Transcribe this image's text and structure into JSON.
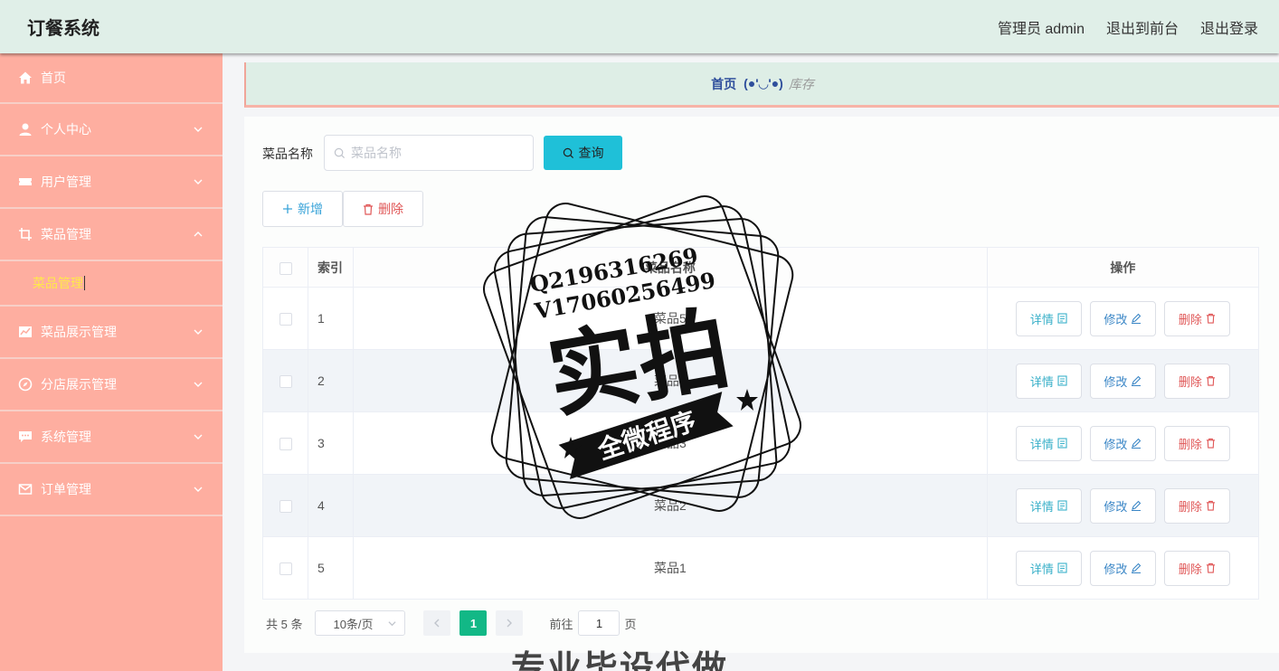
{
  "app": {
    "title": "订餐系统"
  },
  "header": {
    "user_label": "管理员 admin",
    "front_link": "退出到前台",
    "logout_link": "退出登录"
  },
  "sidebar": {
    "items": [
      {
        "label": "首页",
        "icon": "home-icon"
      },
      {
        "label": "个人中心",
        "icon": "user-icon"
      },
      {
        "label": "用户管理",
        "icon": "ticket-icon"
      },
      {
        "label": "菜品管理",
        "icon": "crop-icon",
        "expanded": true
      },
      {
        "label": "菜品展示管理",
        "icon": "chart-icon"
      },
      {
        "label": "分店展示管理",
        "icon": "compass-icon"
      },
      {
        "label": "系统管理",
        "icon": "chat-icon"
      },
      {
        "label": "订单管理",
        "icon": "mail-icon"
      }
    ],
    "active_sub": "菜品管理"
  },
  "breadcrumb": {
    "home": "首页",
    "face": "(●'◡'●)",
    "current": "库存"
  },
  "search": {
    "label": "菜品名称",
    "placeholder": "菜品名称",
    "value": "",
    "query_button": "查询"
  },
  "actions": {
    "add": "新增",
    "delete": "删除"
  },
  "table": {
    "headers": {
      "index": "索引",
      "name": "菜品名称",
      "ops": "操作"
    },
    "rows": [
      {
        "index": "1",
        "name": "菜品5"
      },
      {
        "index": "2",
        "name": "菜品4"
      },
      {
        "index": "3",
        "name": "菜品3"
      },
      {
        "index": "4",
        "name": "菜品2"
      },
      {
        "index": "5",
        "name": "菜品1"
      }
    ],
    "row_buttons": {
      "detail": "详情",
      "edit": "修改",
      "delete": "删除"
    }
  },
  "pagination": {
    "total_text": "共 5 条",
    "page_size": "10条/页",
    "current_page": "1",
    "goto_prefix": "前往",
    "goto_value": "1",
    "goto_suffix": "页"
  },
  "watermark": {
    "contact_q": "Q2196316269",
    "contact_v": "V17060256499",
    "big_text": "实拍",
    "ribbon_text": "全微程序",
    "bottom_text": "专业毕设代做"
  },
  "colors": {
    "topbar": "#e0efe8",
    "sidebar": "#feaea0",
    "active_sub": "#ffe94a",
    "query_button": "#1fc0d8",
    "page_active": "#12b886"
  }
}
